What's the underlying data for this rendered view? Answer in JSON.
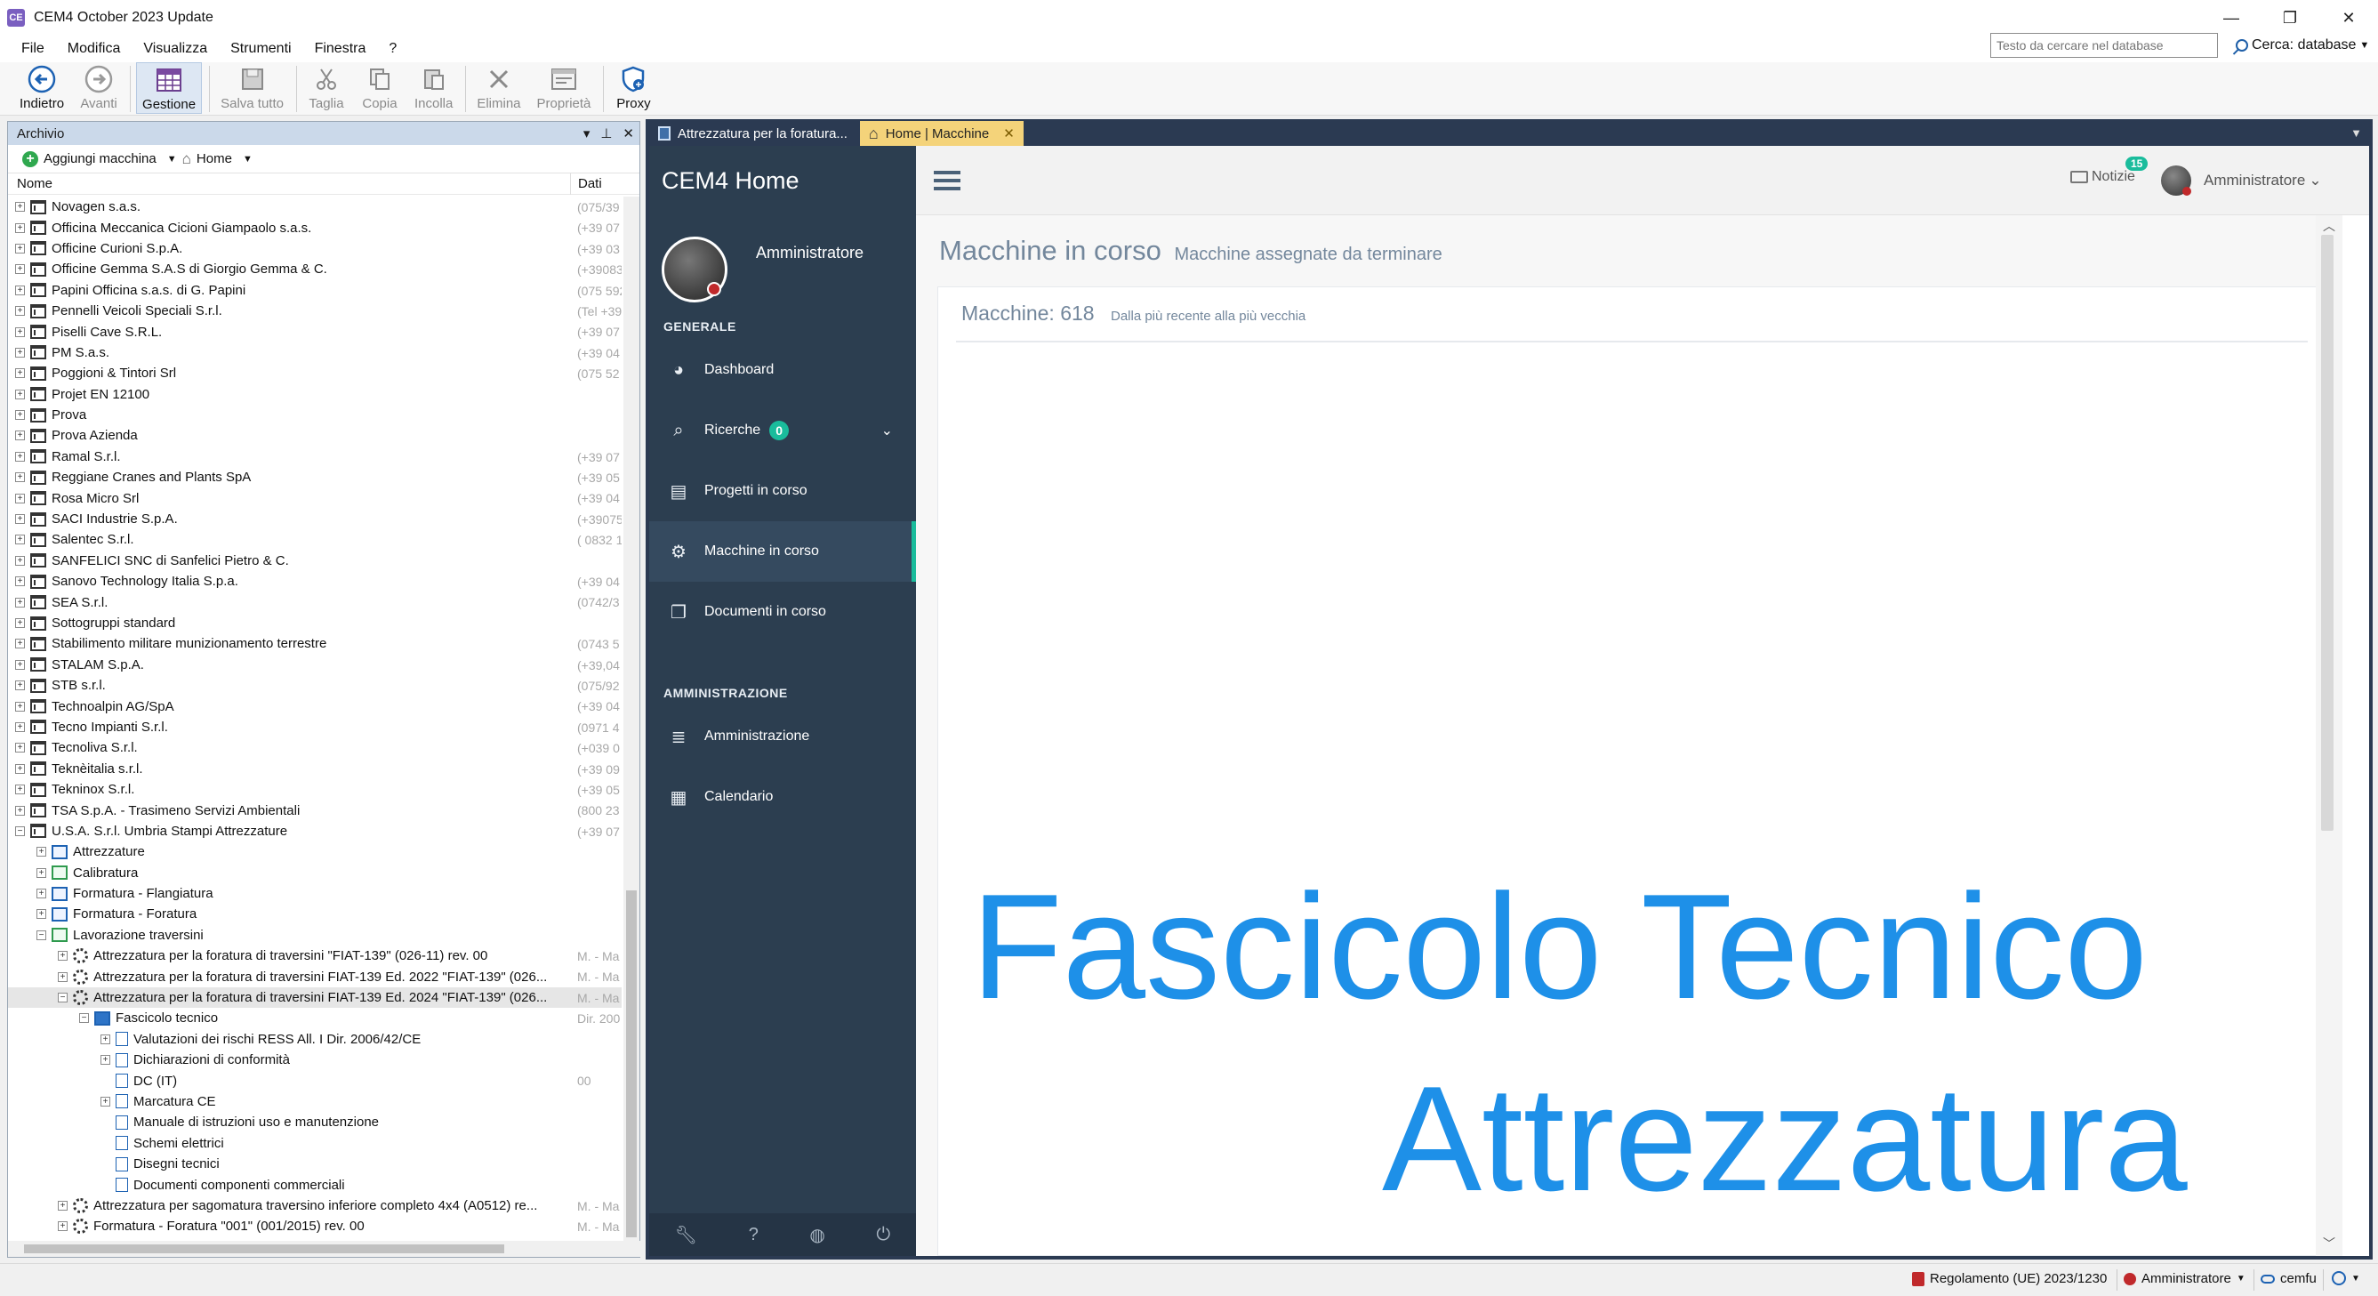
{
  "window": {
    "title": "CEM4 October 2023 Update",
    "app_icon_text": "CE",
    "minimize": "—",
    "restore": "❐",
    "close": "✕"
  },
  "menubar": {
    "items": [
      "File",
      "Modifica",
      "Visualizza",
      "Strumenti",
      "Finestra",
      "?"
    ]
  },
  "search": {
    "placeholder": "Testo da cercare nel database",
    "scope_label": "Cerca: database"
  },
  "toolbar": {
    "buttons": [
      {
        "label": "Indietro",
        "icon": "back-arrow-icon",
        "enabled": true
      },
      {
        "label": "Avanti",
        "icon": "forward-arrow-icon",
        "enabled": false
      },
      {
        "label": "Gestione",
        "icon": "grid-icon",
        "enabled": true,
        "selected": true
      },
      {
        "label": "Salva tutto",
        "icon": "save-icon",
        "enabled": false
      },
      {
        "label": "Taglia",
        "icon": "scissors-icon",
        "enabled": false
      },
      {
        "label": "Copia",
        "icon": "copy-icon",
        "enabled": false
      },
      {
        "label": "Incolla",
        "icon": "paste-icon",
        "enabled": false
      },
      {
        "label": "Elimina",
        "icon": "x-icon",
        "enabled": false
      },
      {
        "label": "Proprietà",
        "icon": "properties-icon",
        "enabled": false
      },
      {
        "label": "Proxy",
        "icon": "shield-icon",
        "enabled": true
      }
    ]
  },
  "archivio": {
    "title": "Archivio",
    "add_button": "Aggiungi macchina",
    "home_button": "Home",
    "col_name": "Nome",
    "col_data": "Dati",
    "rows": [
      {
        "indent": 0,
        "exp": "+",
        "icon": "bld",
        "name": "Novagen s.a.s.",
        "data": "(075/39"
      },
      {
        "indent": 0,
        "exp": "+",
        "icon": "bld",
        "name": "Officina Meccanica Cicioni Giampaolo s.a.s.",
        "data": "(+39 07"
      },
      {
        "indent": 0,
        "exp": "+",
        "icon": "bld",
        "name": "Officine Curioni S.p.A.",
        "data": "(+39 03"
      },
      {
        "indent": 0,
        "exp": "+",
        "icon": "bld",
        "name": "Officine Gemma S.A.S di Giorgio Gemma & C.",
        "data": "(+39083"
      },
      {
        "indent": 0,
        "exp": "+",
        "icon": "bld",
        "name": "Papini Officina s.a.s. di G. Papini",
        "data": "(075 592"
      },
      {
        "indent": 0,
        "exp": "+",
        "icon": "bld",
        "name": "Pennelli Veicoli Speciali S.r.l.",
        "data": "(Tel +39"
      },
      {
        "indent": 0,
        "exp": "+",
        "icon": "bld",
        "name": "Piselli Cave S.R.L.",
        "data": "(+39 07"
      },
      {
        "indent": 0,
        "exp": "+",
        "icon": "bld",
        "name": "PM S.a.s.",
        "data": "(+39 04"
      },
      {
        "indent": 0,
        "exp": "+",
        "icon": "bld",
        "name": "Poggioni & Tintori Srl",
        "data": "(075 52"
      },
      {
        "indent": 0,
        "exp": "+",
        "icon": "bld",
        "name": "Projet EN 12100",
        "data": ""
      },
      {
        "indent": 0,
        "exp": "+",
        "icon": "bld",
        "name": "Prova",
        "data": ""
      },
      {
        "indent": 0,
        "exp": "+",
        "icon": "bld",
        "name": "Prova Azienda",
        "data": ""
      },
      {
        "indent": 0,
        "exp": "+",
        "icon": "bld",
        "name": "Ramal S.r.l.",
        "data": "(+39 07"
      },
      {
        "indent": 0,
        "exp": "+",
        "icon": "bld",
        "name": "Reggiane Cranes and Plants SpA",
        "data": "(+39 05"
      },
      {
        "indent": 0,
        "exp": "+",
        "icon": "bld",
        "name": "Rosa Micro Srl",
        "data": "(+39 04"
      },
      {
        "indent": 0,
        "exp": "+",
        "icon": "bld",
        "name": "SACI Industrie S.p.A.",
        "data": "(+39075"
      },
      {
        "indent": 0,
        "exp": "+",
        "icon": "bld",
        "name": "Salentec S.r.l.",
        "data": "( 0832 1"
      },
      {
        "indent": 0,
        "exp": "+",
        "icon": "bld",
        "name": "SANFELICI SNC di Sanfelici Pietro & C.",
        "data": ""
      },
      {
        "indent": 0,
        "exp": "+",
        "icon": "bld",
        "name": "Sanovo Technology Italia S.p.a.",
        "data": "(+39 04"
      },
      {
        "indent": 0,
        "exp": "+",
        "icon": "bld",
        "name": "SEA S.r.l.",
        "data": "(0742/3"
      },
      {
        "indent": 0,
        "exp": "+",
        "icon": "bld",
        "name": "Sottogruppi standard",
        "data": ""
      },
      {
        "indent": 0,
        "exp": "+",
        "icon": "bld",
        "name": "Stabilimento militare munizionamento terrestre",
        "data": "(0743 5"
      },
      {
        "indent": 0,
        "exp": "+",
        "icon": "bld",
        "name": "STALAM S.p.A.",
        "data": "(+39,04"
      },
      {
        "indent": 0,
        "exp": "+",
        "icon": "bld",
        "name": "STB s.r.l.",
        "data": "(075/92"
      },
      {
        "indent": 0,
        "exp": "+",
        "icon": "bld",
        "name": "Technoalpin AG/SpA",
        "data": "(+39 04"
      },
      {
        "indent": 0,
        "exp": "+",
        "icon": "bld",
        "name": "Tecno Impianti S.r.l.",
        "data": "(0971 4"
      },
      {
        "indent": 0,
        "exp": "+",
        "icon": "bld",
        "name": "Tecnoliva S.r.l.",
        "data": "(+039 0"
      },
      {
        "indent": 0,
        "exp": "+",
        "icon": "bld",
        "name": "Teknèitalia s.r.l.",
        "data": "(+39 09"
      },
      {
        "indent": 0,
        "exp": "+",
        "icon": "bld",
        "name": "Tekninox S.r.l.",
        "data": "(+39 05"
      },
      {
        "indent": 0,
        "exp": "+",
        "icon": "bld",
        "name": "TSA S.p.A. - Trasimeno Servizi Ambientali",
        "data": "(800 23"
      },
      {
        "indent": 0,
        "exp": "−",
        "icon": "bld",
        "name": "U.S.A. S.r.l. Umbria Stampi Attrezzature",
        "data": "(+39 07"
      },
      {
        "indent": 1,
        "exp": "+",
        "icon": "grp",
        "name": "Attrezzature",
        "data": ""
      },
      {
        "indent": 1,
        "exp": "+",
        "icon": "grpg",
        "name": "Calibratura",
        "data": ""
      },
      {
        "indent": 1,
        "exp": "+",
        "icon": "grp",
        "name": "Formatura - Flangiatura",
        "data": ""
      },
      {
        "indent": 1,
        "exp": "+",
        "icon": "grp",
        "name": "Formatura - Foratura",
        "data": ""
      },
      {
        "indent": 1,
        "exp": "−",
        "icon": "grpg",
        "name": "Lavorazione traversini",
        "data": ""
      },
      {
        "indent": 2,
        "exp": "+",
        "icon": "gear",
        "name": "Attrezzatura per la foratura di traversini \"FIAT-139\" (026-11) rev. 00",
        "data": "M. - Ma"
      },
      {
        "indent": 2,
        "exp": "+",
        "icon": "gear",
        "name": "Attrezzatura per la foratura di traversini FIAT-139 Ed. 2022 \"FIAT-139\" (026...",
        "data": "M. - Ma"
      },
      {
        "indent": 2,
        "exp": "−",
        "icon": "gear",
        "name": "Attrezzatura per la foratura di traversini FIAT-139 Ed. 2024 \"FIAT-139\" (026...",
        "data": "M. - Ma",
        "selected": true
      },
      {
        "indent": 3,
        "exp": "−",
        "icon": "folder",
        "name": "Fascicolo tecnico",
        "data": "Dir. 200"
      },
      {
        "indent": 4,
        "exp": "+",
        "icon": "doc",
        "name": "Valutazioni dei rischi RESS All. I Dir. 2006/42/CE",
        "data": ""
      },
      {
        "indent": 4,
        "exp": "+",
        "icon": "doc",
        "name": "Dichiarazioni di conformità",
        "data": ""
      },
      {
        "indent": 4,
        "exp": "",
        "icon": "doc",
        "name": "DC (IT)",
        "data": "00"
      },
      {
        "indent": 4,
        "exp": "+",
        "icon": "doc",
        "name": "Marcatura CE",
        "data": ""
      },
      {
        "indent": 4,
        "exp": "",
        "icon": "doc",
        "name": "Manuale di istruzioni uso e manutenzione",
        "data": ""
      },
      {
        "indent": 4,
        "exp": "",
        "icon": "doc",
        "name": "Schemi elettrici",
        "data": ""
      },
      {
        "indent": 4,
        "exp": "",
        "icon": "doc",
        "name": "Disegni tecnici",
        "data": ""
      },
      {
        "indent": 4,
        "exp": "",
        "icon": "doc",
        "name": "Documenti componenti commerciali",
        "data": ""
      },
      {
        "indent": 2,
        "exp": "+",
        "icon": "gear",
        "name": "Attrezzatura per sagomatura traversino inferiore completo 4x4 (A0512) re...",
        "data": "M. - Ma"
      },
      {
        "indent": 2,
        "exp": "+",
        "icon": "gear",
        "name": "Formatura - Foratura \"001\" (001/2015) rev. 00",
        "data": "M. - Ma"
      }
    ]
  },
  "tabs": [
    {
      "label": "Attrezzatura per la foratura...",
      "active": false
    },
    {
      "label": "Home | Macchine",
      "active": true
    }
  ],
  "web": {
    "brand": "CEM4 Home",
    "user": "Amministratore",
    "section_general": "GENERALE",
    "section_admin": "AMMINISTRAZIONE",
    "nav": [
      {
        "label": "Dashboard",
        "icon": "tachometer-icon"
      },
      {
        "label": "Ricerche",
        "icon": "search-icon",
        "badge": "0"
      },
      {
        "label": "Progetti in corso",
        "icon": "book-icon"
      },
      {
        "label": "Macchine in corso",
        "icon": "cogs-icon",
        "active": true
      },
      {
        "label": "Documenti in corso",
        "icon": "copy-icon"
      }
    ],
    "nav_admin": [
      {
        "label": "Amministrazione",
        "icon": "database-icon"
      },
      {
        "label": "Calendario",
        "icon": "calendar-icon"
      }
    ],
    "notizie_label": "Notizie",
    "notizie_count": "15",
    "top_user": "Amministratore",
    "page_title": "Macchine in corso",
    "page_subtitle": "Macchine assegnate da terminare",
    "panel_title": "Macchine: 618",
    "panel_subtitle": "Dalla più recente alla più vecchia",
    "overlay_line1": "Fascicolo Tecnico",
    "overlay_line2": "Attrezzatura"
  },
  "statusbar": {
    "regulation": "Regolamento (UE) 2023/1230",
    "user": "Amministratore",
    "connection": "cemfu"
  }
}
